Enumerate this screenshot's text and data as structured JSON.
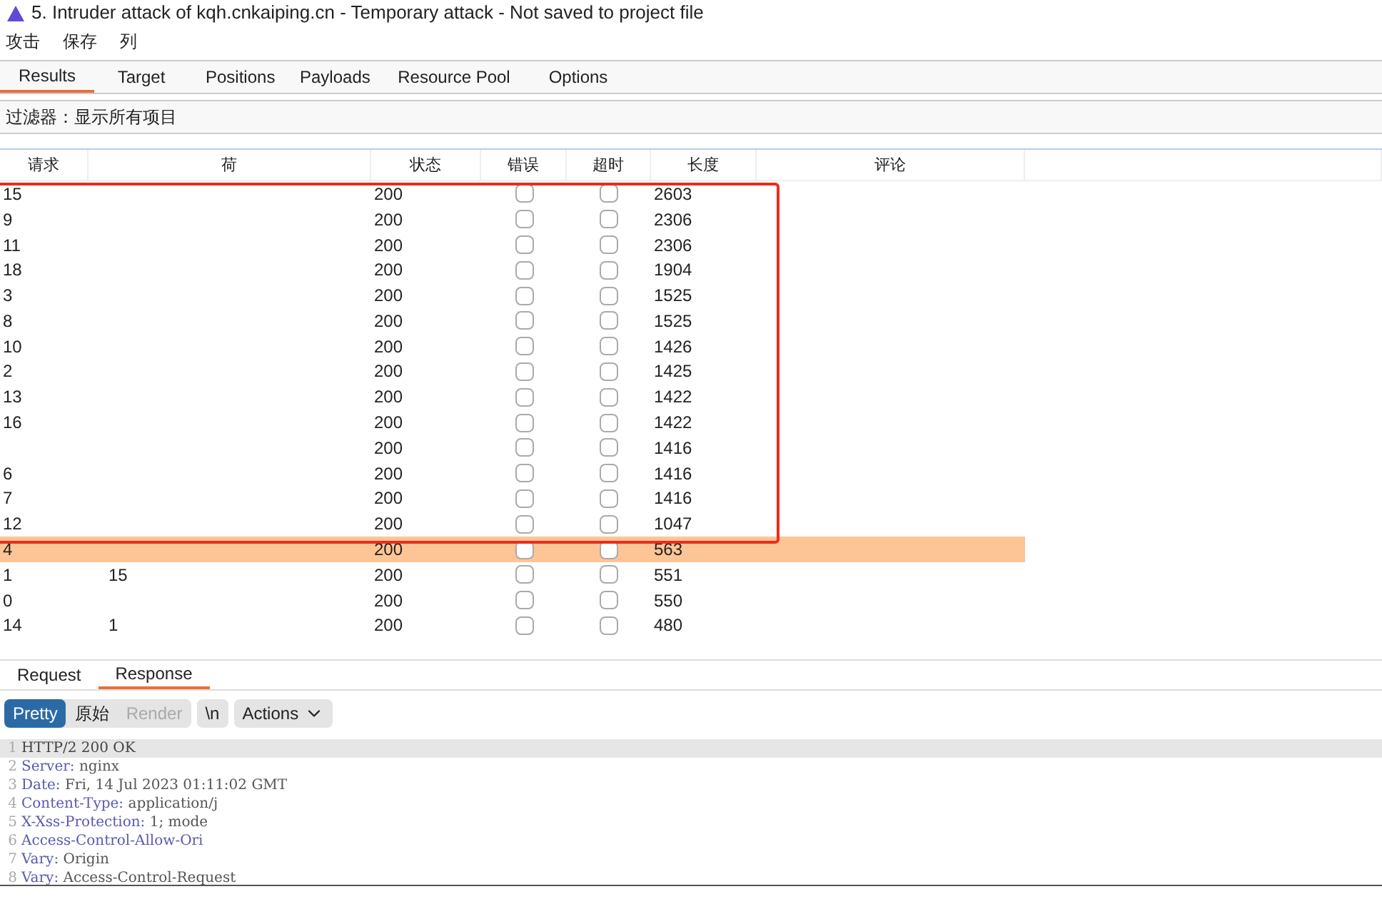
{
  "window": {
    "title": "5. Intruder attack of kqh.cnkaiping.cn - Temporary attack - Not saved to project file"
  },
  "menu": [
    "攻击",
    "保存",
    "列"
  ],
  "tabs": [
    {
      "label": "Results",
      "selected": true
    },
    {
      "label": "Target",
      "selected": false
    },
    {
      "label": "Positions",
      "selected": false
    },
    {
      "label": "Payloads",
      "selected": false
    },
    {
      "label": "Resource Pool",
      "selected": false
    },
    {
      "label": "Options",
      "selected": false
    }
  ],
  "filter": "过滤器：显示所有项目",
  "table": {
    "columns": [
      "请求",
      "荷",
      "状态",
      "错误",
      "超时",
      "长度",
      "评论"
    ],
    "rows": [
      {
        "request": "15",
        "payload": "",
        "status": "200",
        "error": false,
        "timeout": false,
        "length": "2603",
        "selected": false
      },
      {
        "request": "9",
        "payload": "",
        "status": "200",
        "error": false,
        "timeout": false,
        "length": "2306",
        "selected": false
      },
      {
        "request": "11",
        "payload": "",
        "status": "200",
        "error": false,
        "timeout": false,
        "length": "2306",
        "selected": false
      },
      {
        "request": "18",
        "payload": "",
        "status": "200",
        "error": false,
        "timeout": false,
        "length": "1904",
        "selected": false
      },
      {
        "request": "3",
        "payload": "",
        "status": "200",
        "error": false,
        "timeout": false,
        "length": "1525",
        "selected": false
      },
      {
        "request": "8",
        "payload": "",
        "status": "200",
        "error": false,
        "timeout": false,
        "length": "1525",
        "selected": false
      },
      {
        "request": "10",
        "payload": "",
        "status": "200",
        "error": false,
        "timeout": false,
        "length": "1426",
        "selected": false
      },
      {
        "request": "2",
        "payload": "",
        "status": "200",
        "error": false,
        "timeout": false,
        "length": "1425",
        "selected": false
      },
      {
        "request": "13",
        "payload": "",
        "status": "200",
        "error": false,
        "timeout": false,
        "length": "1422",
        "selected": false
      },
      {
        "request": "16",
        "payload": "",
        "status": "200",
        "error": false,
        "timeout": false,
        "length": "1422",
        "selected": false
      },
      {
        "request": "",
        "payload": "",
        "status": "200",
        "error": false,
        "timeout": false,
        "length": "1416",
        "selected": false
      },
      {
        "request": "6",
        "payload": "",
        "status": "200",
        "error": false,
        "timeout": false,
        "length": "1416",
        "selected": false
      },
      {
        "request": "7",
        "payload": "",
        "status": "200",
        "error": false,
        "timeout": false,
        "length": "1416",
        "selected": false
      },
      {
        "request": "12",
        "payload": "",
        "status": "200",
        "error": false,
        "timeout": false,
        "length": "1047",
        "selected": false
      },
      {
        "request": "4",
        "payload": "",
        "status": "200",
        "error": false,
        "timeout": false,
        "length": "563",
        "selected": true
      },
      {
        "request": "1",
        "payload": "15",
        "status": "200",
        "error": false,
        "timeout": false,
        "length": "551",
        "selected": false
      },
      {
        "request": "0",
        "payload": "",
        "status": "200",
        "error": false,
        "timeout": false,
        "length": "550",
        "selected": false
      },
      {
        "request": "14",
        "payload": "1",
        "status": "200",
        "error": false,
        "timeout": false,
        "length": "480",
        "selected": false
      }
    ]
  },
  "detail_tabs": [
    {
      "label": "Request",
      "selected": false
    },
    {
      "label": "Response",
      "selected": true
    }
  ],
  "view_buttons": [
    {
      "label": "Pretty",
      "selected": true,
      "disabled": false
    },
    {
      "label": "原始",
      "selected": false,
      "disabled": false
    },
    {
      "label": "Render",
      "selected": false,
      "disabled": true
    }
  ],
  "newline_button": "\\n",
  "actions_button": "Actions",
  "code_lines": [
    {
      "number": "1",
      "key": "HTTP/2 200 OK"
    },
    {
      "number": "2",
      "key": "Server:",
      "value": " nginx"
    },
    {
      "number": "3",
      "key": "Date:",
      "value": " Fri, 14 Jul 2023 01:11:02 GMT"
    },
    {
      "number": "4",
      "key": "Content-Type:",
      "value": " application/j"
    },
    {
      "number": "5",
      "key": "X-Xss-Protection:",
      "value": " 1; mode"
    },
    {
      "number": "6",
      "key": "Access-Control-Allow-Ori"
    },
    {
      "number": "7",
      "key": "Vary:",
      "value": " Origin"
    },
    {
      "number": "8",
      "key": "Vary:",
      "value": " Access-Control-Request"
    }
  ]
}
